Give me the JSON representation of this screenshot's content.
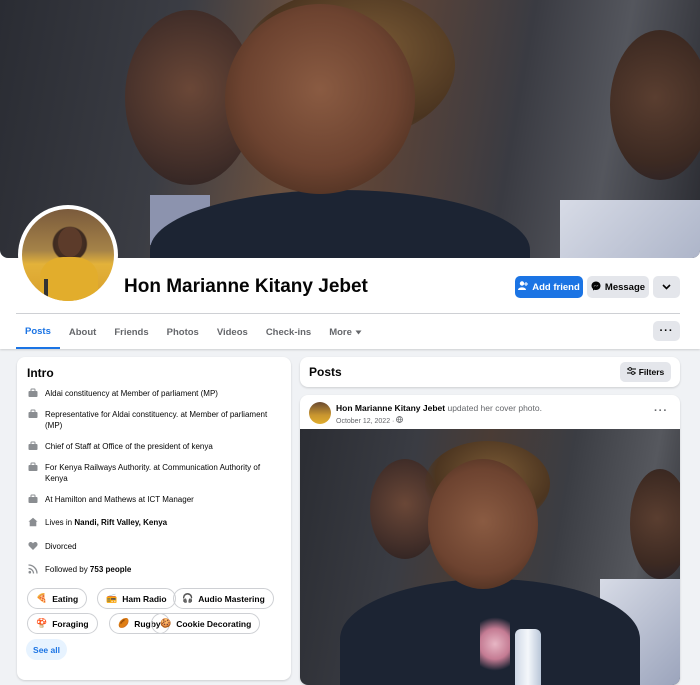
{
  "profile": {
    "name": "Hon Marianne Kitany Jebet",
    "add_friend_label": "Add friend",
    "message_label": "Message"
  },
  "tabs": [
    {
      "label": "Posts",
      "active": true
    },
    {
      "label": "About"
    },
    {
      "label": "Friends"
    },
    {
      "label": "Photos"
    },
    {
      "label": "Videos"
    },
    {
      "label": "Check-ins"
    },
    {
      "label": "More"
    }
  ],
  "intro": {
    "title": "Intro",
    "items": [
      {
        "icon": "work-icon",
        "text": "Aldai constituency at Member of parliament (MP)"
      },
      {
        "icon": "work-icon",
        "text": "Representative for Aldai constituency. at Member of parliament (MP)"
      },
      {
        "icon": "work-icon",
        "text": "Chief of Staff at Office of the president of kenya"
      },
      {
        "icon": "work-icon",
        "text": "For Kenya Railways Authority. at Communication Authority of Kenya"
      },
      {
        "icon": "work-icon",
        "text": "At Hamilton and Mathews at ICT Manager"
      },
      {
        "icon": "home-icon",
        "prefix": "Lives in ",
        "bold": "Nandi, Rift Valley, Kenya"
      },
      {
        "icon": "heart-icon",
        "text": "Divorced"
      },
      {
        "icon": "rss-icon",
        "prefix": "Followed by ",
        "bold": "753 people"
      }
    ],
    "hobbies": [
      {
        "emoji": "🍕",
        "label": "Eating"
      },
      {
        "emoji": "📻",
        "label": "Ham Radio"
      },
      {
        "emoji": "🎧",
        "label": "Audio Mastering"
      },
      {
        "emoji": "🍄",
        "label": "Foraging"
      },
      {
        "emoji": "🏉",
        "label": "Rugby"
      },
      {
        "emoji": "🍪",
        "label": "Cookie Decorating"
      }
    ],
    "see_all_label": "See all"
  },
  "posts": {
    "title": "Posts",
    "filters_label": "Filters",
    "post": {
      "author": "Hon Marianne Kitany Jebet",
      "action": " updated her cover photo.",
      "date": "October 12, 2022 · ",
      "privacy_icon": "globe-icon"
    }
  }
}
